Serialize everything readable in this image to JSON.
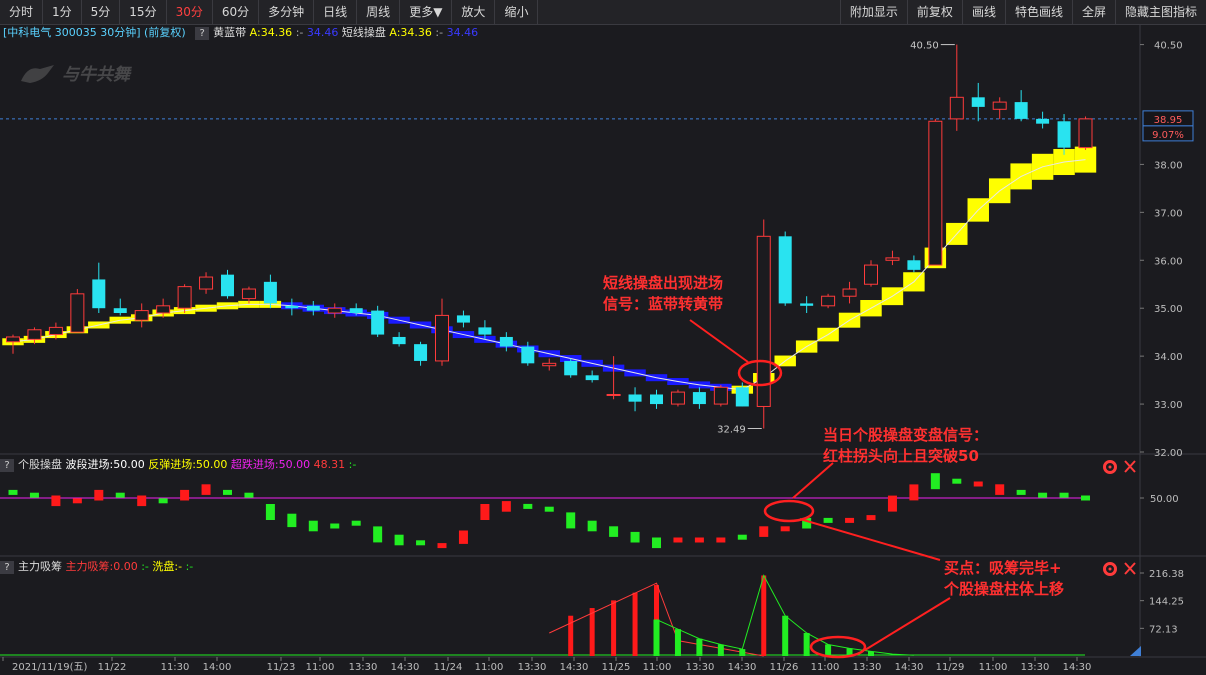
{
  "toolbar": {
    "left": [
      "分时",
      "1分",
      "5分",
      "15分",
      "30分",
      "60分",
      "多分钟",
      "日线",
      "周线",
      "更多▼",
      "放大",
      "缩小"
    ],
    "active": "30分",
    "right": [
      "附加显示",
      "前复权",
      "画线",
      "特色画线",
      "全屏",
      "隐藏主图指标"
    ]
  },
  "info": {
    "stock": "[中科电气 300035 30分钟] (前复权)",
    "ind1_name": "黄蓝带",
    "ind1_a": "A:34.36",
    "ind1_b": "34.46",
    "ind2_name": "短线操盘",
    "ind2_a": "A:34.36",
    "ind2_b": "34.46",
    "sep": ":-"
  },
  "watermark": "与牛共舞",
  "price_axis": {
    "ticks": [
      "40.50",
      "38.00",
      "37.00",
      "36.00",
      "35.00",
      "34.00",
      "33.00",
      "32.00"
    ],
    "current": "38.95",
    "change": "9.07%"
  },
  "markers": {
    "high": "40.50",
    "low": "32.49"
  },
  "sub1": {
    "name": "个股操盘",
    "p1": "波段进场:50.00",
    "p2": "反弹进场:50.00",
    "p3": "超跌进场:50.00",
    "p4": "48.31",
    "p5": ":-",
    "axis": "50.00"
  },
  "sub2": {
    "name": "主力吸筹",
    "p1": "主力吸筹:0.00",
    "p2": ":-",
    "p3": "洗盘:-",
    "p4": ":-",
    "axis": [
      "216.38",
      "144.25",
      "72.13"
    ]
  },
  "time_axis": [
    "2021/11/19(五)",
    "11/22",
    "11:30",
    "14:00",
    "11/23",
    "11:00",
    "13:30",
    "14:30",
    "11/24",
    "11:00",
    "13:30",
    "14:30",
    "11/25",
    "11:00",
    "13:30",
    "14:30",
    "11/26",
    "11:00",
    "13:30",
    "14:30",
    "11/29",
    "11:00",
    "13:30",
    "14:30"
  ],
  "annotations": {
    "a1_l1": "短线操盘出现进场",
    "a1_l2": "信号：蓝带转黄带",
    "a2_l1": "当日个股操盘变盘信号：",
    "a2_l2": "红柱拐头向上且突破50",
    "a3_l1": "买点：吸筹完毕+",
    "a3_l2": "个股操盘柱体上移"
  },
  "colors": {
    "up": "#ff3b3b",
    "down": "#29e3f0",
    "yellow": "#ffff00",
    "blue": "#1a1aff",
    "green": "#22ee22",
    "magenta": "#ee22ee"
  },
  "chart_data": {
    "type": "candlestick",
    "ylim": [
      32.0,
      40.7
    ],
    "candles": [
      {
        "o": 34.3,
        "h": 34.45,
        "l": 34.05,
        "c": 34.4
      },
      {
        "o": 34.35,
        "h": 34.6,
        "l": 34.25,
        "c": 34.55
      },
      {
        "o": 34.45,
        "h": 34.7,
        "l": 34.35,
        "c": 34.6
      },
      {
        "o": 34.5,
        "h": 35.4,
        "l": 34.5,
        "c": 35.3
      },
      {
        "o": 35.6,
        "h": 35.95,
        "l": 34.9,
        "c": 35.0
      },
      {
        "o": 35.0,
        "h": 35.2,
        "l": 34.85,
        "c": 34.9
      },
      {
        "o": 34.75,
        "h": 35.1,
        "l": 34.6,
        "c": 34.95
      },
      {
        "o": 34.9,
        "h": 35.2,
        "l": 34.8,
        "c": 35.05
      },
      {
        "o": 35.0,
        "h": 35.5,
        "l": 34.9,
        "c": 35.45
      },
      {
        "o": 35.4,
        "h": 35.75,
        "l": 35.3,
        "c": 35.65
      },
      {
        "o": 35.7,
        "h": 35.8,
        "l": 35.2,
        "c": 35.25
      },
      {
        "o": 35.2,
        "h": 35.45,
        "l": 35.1,
        "c": 35.4
      },
      {
        "o": 35.55,
        "h": 35.7,
        "l": 35.0,
        "c": 35.1
      },
      {
        "o": 35.05,
        "h": 35.2,
        "l": 34.85,
        "c": 35.0
      },
      {
        "o": 35.05,
        "h": 35.15,
        "l": 34.85,
        "c": 34.95
      },
      {
        "o": 34.9,
        "h": 35.1,
        "l": 34.8,
        "c": 35.0
      },
      {
        "o": 35.0,
        "h": 35.1,
        "l": 34.85,
        "c": 34.9
      },
      {
        "o": 34.95,
        "h": 35.05,
        "l": 34.4,
        "c": 34.45
      },
      {
        "o": 34.4,
        "h": 34.5,
        "l": 34.2,
        "c": 34.25
      },
      {
        "o": 34.25,
        "h": 34.3,
        "l": 33.8,
        "c": 33.9
      },
      {
        "o": 33.9,
        "h": 35.2,
        "l": 33.8,
        "c": 34.85
      },
      {
        "o": 34.85,
        "h": 34.95,
        "l": 34.6,
        "c": 34.7
      },
      {
        "o": 34.6,
        "h": 34.75,
        "l": 34.35,
        "c": 34.45
      },
      {
        "o": 34.4,
        "h": 34.5,
        "l": 34.1,
        "c": 34.2
      },
      {
        "o": 34.2,
        "h": 34.3,
        "l": 33.8,
        "c": 33.85
      },
      {
        "o": 33.8,
        "h": 33.95,
        "l": 33.7,
        "c": 33.85
      },
      {
        "o": 33.9,
        "h": 33.95,
        "l": 33.55,
        "c": 33.6
      },
      {
        "o": 33.6,
        "h": 33.7,
        "l": 33.45,
        "c": 33.5
      },
      {
        "o": 33.2,
        "h": 34.0,
        "l": 33.1,
        "c": 33.2
      },
      {
        "o": 33.2,
        "h": 33.35,
        "l": 32.85,
        "c": 33.05
      },
      {
        "o": 33.2,
        "h": 33.3,
        "l": 32.9,
        "c": 33.0
      },
      {
        "o": 33.0,
        "h": 33.3,
        "l": 32.95,
        "c": 33.25
      },
      {
        "o": 33.25,
        "h": 33.35,
        "l": 32.9,
        "c": 33.0
      },
      {
        "o": 33.0,
        "h": 33.4,
        "l": 32.95,
        "c": 33.35
      },
      {
        "o": 33.35,
        "h": 33.45,
        "l": 32.95,
        "c": 32.95
      },
      {
        "o": 32.95,
        "h": 36.85,
        "l": 32.49,
        "c": 36.5
      },
      {
        "o": 36.5,
        "h": 36.6,
        "l": 35.05,
        "c": 35.1
      },
      {
        "o": 35.1,
        "h": 35.25,
        "l": 34.9,
        "c": 35.05
      },
      {
        "o": 35.05,
        "h": 35.3,
        "l": 35.0,
        "c": 35.25
      },
      {
        "o": 35.25,
        "h": 35.55,
        "l": 35.1,
        "c": 35.4
      },
      {
        "o": 35.5,
        "h": 36.0,
        "l": 35.45,
        "c": 35.9
      },
      {
        "o": 36.0,
        "h": 36.2,
        "l": 35.9,
        "c": 36.05
      },
      {
        "o": 36.0,
        "h": 36.1,
        "l": 35.75,
        "c": 35.8
      },
      {
        "o": 35.9,
        "h": 38.95,
        "l": 35.9,
        "c": 38.9
      },
      {
        "o": 38.95,
        "h": 40.5,
        "l": 38.7,
        "c": 39.4
      },
      {
        "o": 39.4,
        "h": 39.7,
        "l": 38.9,
        "c": 39.2
      },
      {
        "o": 39.15,
        "h": 39.4,
        "l": 38.95,
        "c": 39.3
      },
      {
        "o": 39.3,
        "h": 39.55,
        "l": 38.9,
        "c": 38.95
      },
      {
        "o": 38.95,
        "h": 39.1,
        "l": 38.75,
        "c": 38.85
      },
      {
        "o": 38.9,
        "h": 39.05,
        "l": 38.2,
        "c": 38.35
      },
      {
        "o": 38.35,
        "h": 39.0,
        "l": 38.3,
        "c": 38.95
      }
    ],
    "band": [
      34.3,
      34.35,
      34.45,
      34.55,
      34.65,
      34.75,
      34.8,
      34.9,
      34.95,
      35.0,
      35.05,
      35.08,
      35.08,
      35.05,
      35.0,
      34.95,
      34.9,
      34.85,
      34.75,
      34.65,
      34.55,
      34.45,
      34.35,
      34.25,
      34.15,
      34.05,
      33.95,
      33.85,
      33.75,
      33.65,
      33.55,
      33.47,
      33.4,
      33.35,
      33.3,
      33.55,
      33.9,
      34.2,
      34.45,
      34.75,
      35.0,
      35.25,
      35.55,
      36.05,
      36.55,
      37.05,
      37.45,
      37.75,
      37.95,
      38.05,
      38.1
    ],
    "band_color": [
      "y",
      "y",
      "y",
      "y",
      "y",
      "y",
      "y",
      "y",
      "y",
      "y",
      "y",
      "y",
      "y",
      "b",
      "b",
      "b",
      "b",
      "b",
      "b",
      "b",
      "b",
      "b",
      "b",
      "b",
      "b",
      "b",
      "b",
      "b",
      "b",
      "b",
      "b",
      "b",
      "b",
      "b",
      "y",
      "y",
      "y",
      "y",
      "y",
      "y",
      "y",
      "y",
      "y",
      "y",
      "y",
      "y",
      "y",
      "y",
      "y",
      "y",
      "y"
    ],
    "sub1_values": [
      52,
      51,
      49,
      49,
      51,
      51,
      49,
      49,
      51,
      53,
      52,
      51,
      45,
      42,
      40,
      40,
      41,
      37,
      35,
      34,
      33,
      36,
      45,
      47,
      47,
      46,
      42,
      40,
      38,
      36,
      34,
      35,
      35,
      35,
      36,
      38,
      39,
      41,
      42,
      42,
      43,
      48,
      52,
      56,
      56,
      55,
      53,
      52,
      51,
      51,
      50
    ],
    "sub1_colors": [
      "g",
      "g",
      "r",
      "r",
      "r",
      "g",
      "r",
      "g",
      "r",
      "r",
      "g",
      "g",
      "g",
      "g",
      "g",
      "g",
      "g",
      "g",
      "g",
      "g",
      "r",
      "r",
      "r",
      "r",
      "g",
      "g",
      "g",
      "g",
      "g",
      "g",
      "g",
      "r",
      "r",
      "r",
      "g",
      "r",
      "r",
      "g",
      "g",
      "r",
      "r",
      "r",
      "r",
      "g",
      "g",
      "r",
      "r",
      "g",
      "g",
      "g",
      "g"
    ],
    "sub2_values": [
      0,
      0,
      0,
      0,
      0,
      0,
      0,
      0,
      0,
      0,
      0,
      0,
      0,
      0,
      0,
      0,
      0,
      0,
      0,
      0,
      0,
      0,
      0,
      0,
      0,
      0,
      105,
      125,
      145,
      165,
      185,
      0,
      0,
      0,
      0,
      0,
      0,
      0,
      0,
      0,
      0,
      0,
      0,
      0,
      0,
      0,
      0,
      0,
      0,
      0,
      0
    ]
  }
}
